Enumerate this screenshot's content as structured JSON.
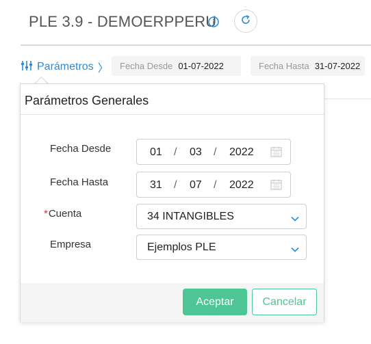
{
  "header": {
    "title": "PLE 3.9 - DEMOERPPERU",
    "info_icon": "info-circle-icon",
    "refresh_icon": "refresh-icon"
  },
  "params_bar": {
    "link_label": "Parámetros",
    "link_icon": "sliders-icon",
    "chevron": "〉",
    "fecha_desde_label": "Fecha Desde",
    "fecha_desde_value": "01-07-2022",
    "fecha_hasta_label": "Fecha Hasta",
    "fecha_hasta_value": "31-07-2022"
  },
  "popover": {
    "title": "Parámetros Generales",
    "fecha_desde": {
      "label": "Fecha Desde",
      "day": "01",
      "month": "03",
      "year": "2022"
    },
    "fecha_hasta": {
      "label": "Fecha Hasta",
      "day": "31",
      "month": "07",
      "year": "2022"
    },
    "date_separator": "/",
    "cuenta": {
      "label": "Cuenta",
      "required_mark": "*",
      "value": "34 INTANGIBLES"
    },
    "empresa": {
      "label": "Empresa",
      "value": "Ejemplos PLE"
    },
    "accept_label": "Aceptar",
    "cancel_label": "Cancelar"
  },
  "colors": {
    "accent_blue": "#2a8bd9",
    "accent_green": "#4dc594",
    "required_red": "#d9342b"
  }
}
